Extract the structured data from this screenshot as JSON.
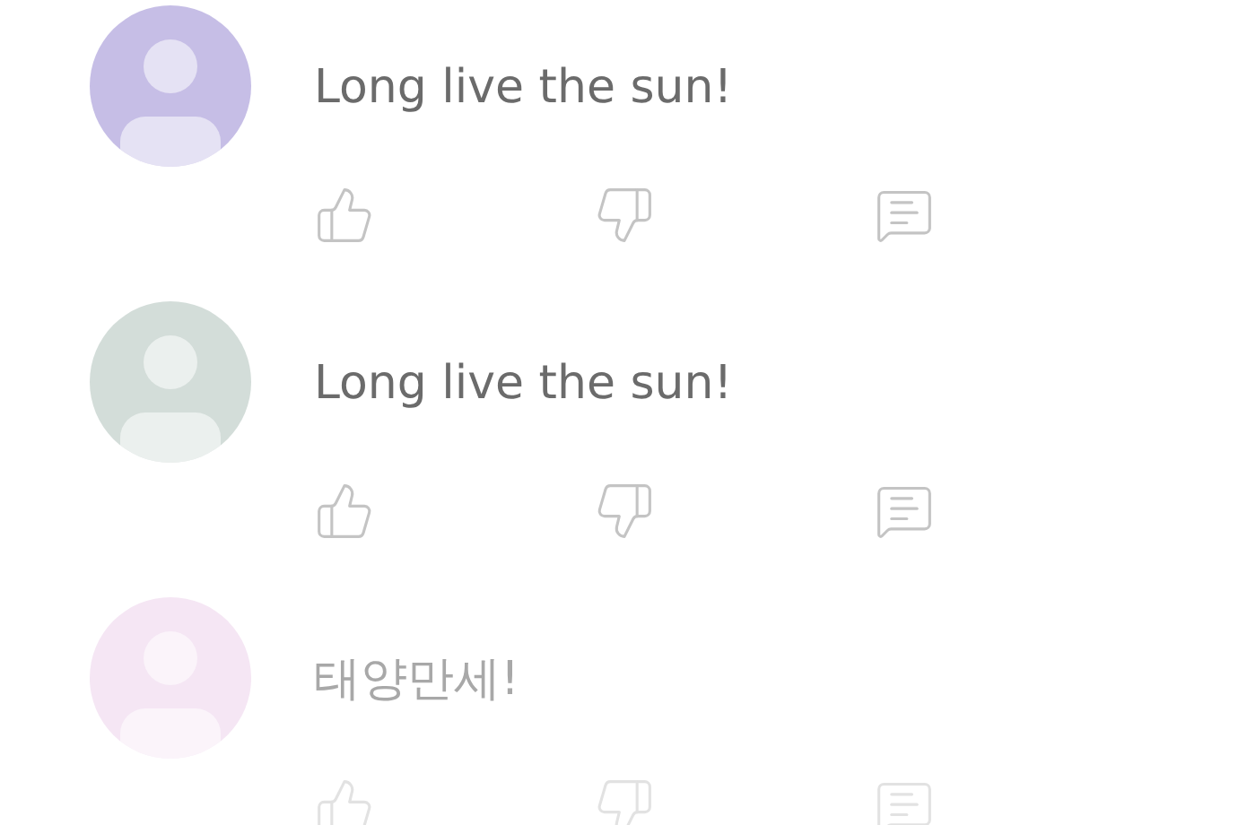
{
  "comments": [
    {
      "text": "Long live the sun!",
      "color": "#c6bee6",
      "faded": false
    },
    {
      "text": "Long live the sun!",
      "color": "#d3ddd9",
      "faded": false
    },
    {
      "text": "태양만세!",
      "color": "#f5e6f4",
      "faded": true
    }
  ]
}
